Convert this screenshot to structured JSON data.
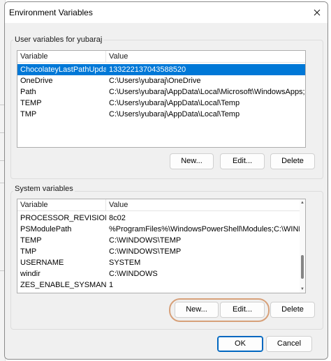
{
  "dialog": {
    "title": "Environment Variables"
  },
  "user_vars": {
    "group_label": "User variables for yubaraj",
    "columns": [
      "Variable",
      "Value"
    ],
    "rows": [
      {
        "variable": "ChocolateyLastPathUpdate",
        "value": "133222137043588520",
        "selected": true
      },
      {
        "variable": "OneDrive",
        "value": "C:\\Users\\yubaraj\\OneDrive",
        "selected": false
      },
      {
        "variable": "Path",
        "value": "C:\\Users\\yubaraj\\AppData\\Local\\Microsoft\\WindowsApps;C:\\...",
        "selected": false
      },
      {
        "variable": "TEMP",
        "value": "C:\\Users\\yubaraj\\AppData\\Local\\Temp",
        "selected": false
      },
      {
        "variable": "TMP",
        "value": "C:\\Users\\yubaraj\\AppData\\Local\\Temp",
        "selected": false
      }
    ],
    "buttons": {
      "new": "New...",
      "edit": "Edit...",
      "delete": "Delete"
    }
  },
  "system_vars": {
    "group_label": "System variables",
    "columns": [
      "Variable",
      "Value"
    ],
    "rows": [
      {
        "variable": "PROCESSOR_REVISION",
        "value": "8c02"
      },
      {
        "variable": "PSModulePath",
        "value": "%ProgramFiles%\\WindowsPowerShell\\Modules;C:\\WINDOWS..."
      },
      {
        "variable": "TEMP",
        "value": "C:\\WINDOWS\\TEMP"
      },
      {
        "variable": "TMP",
        "value": "C:\\WINDOWS\\TEMP"
      },
      {
        "variable": "USERNAME",
        "value": "SYSTEM"
      },
      {
        "variable": "windir",
        "value": "C:\\WINDOWS"
      },
      {
        "variable": "ZES_ENABLE_SYSMAN",
        "value": "1"
      }
    ],
    "buttons": {
      "new": "New...",
      "edit": "Edit...",
      "delete": "Delete"
    },
    "scroll_position": 0.85
  },
  "footer": {
    "ok": "OK",
    "cancel": "Cancel"
  },
  "colors": {
    "selection": "#0078d7",
    "primary_border": "#0067c0",
    "highlight_ring": "#d7a079"
  },
  "icons": {
    "close": "close-icon",
    "scroll_up": "chevron-up-icon",
    "scroll_down": "chevron-down-icon"
  }
}
